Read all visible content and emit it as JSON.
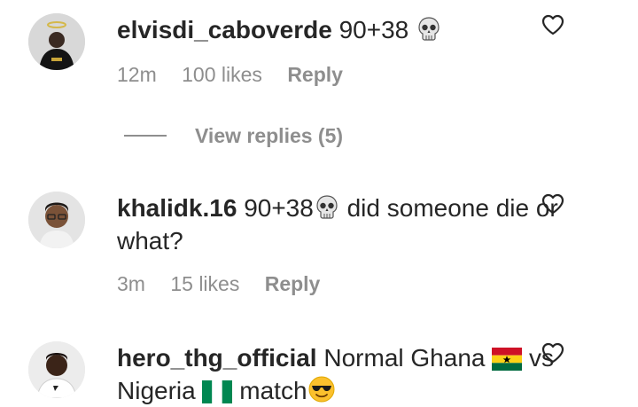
{
  "comments": [
    {
      "username": "elvisdi_caboverde",
      "text_before": "90+38",
      "emoji": "skull-emoji",
      "text_after": "",
      "time": "12m",
      "likes": "100 likes",
      "reply_label": "Reply"
    },
    {
      "username": "khalidk.16",
      "text_before": "90+38",
      "emoji": "skull-emoji",
      "text_after": " did someone die or what?",
      "time": "3m",
      "likes": "15 likes",
      "reply_label": "Reply"
    },
    {
      "username": "hero_thg_official",
      "text_part1": "Normal Ghana",
      "text_part2": "vs Nigeria",
      "text_part3": "match",
      "emoji_ghana": "ghana-flag-emoji",
      "emoji_nigeria": "nigeria-flag-emoji",
      "emoji_end": "sunglasses-emoji"
    }
  ],
  "view_replies": {
    "label": "View replies (5)"
  },
  "icons": {
    "like": "heart-outline-icon"
  },
  "colors": {
    "text": "#262626",
    "muted": "#8e8e8e",
    "background": "#ffffff"
  }
}
